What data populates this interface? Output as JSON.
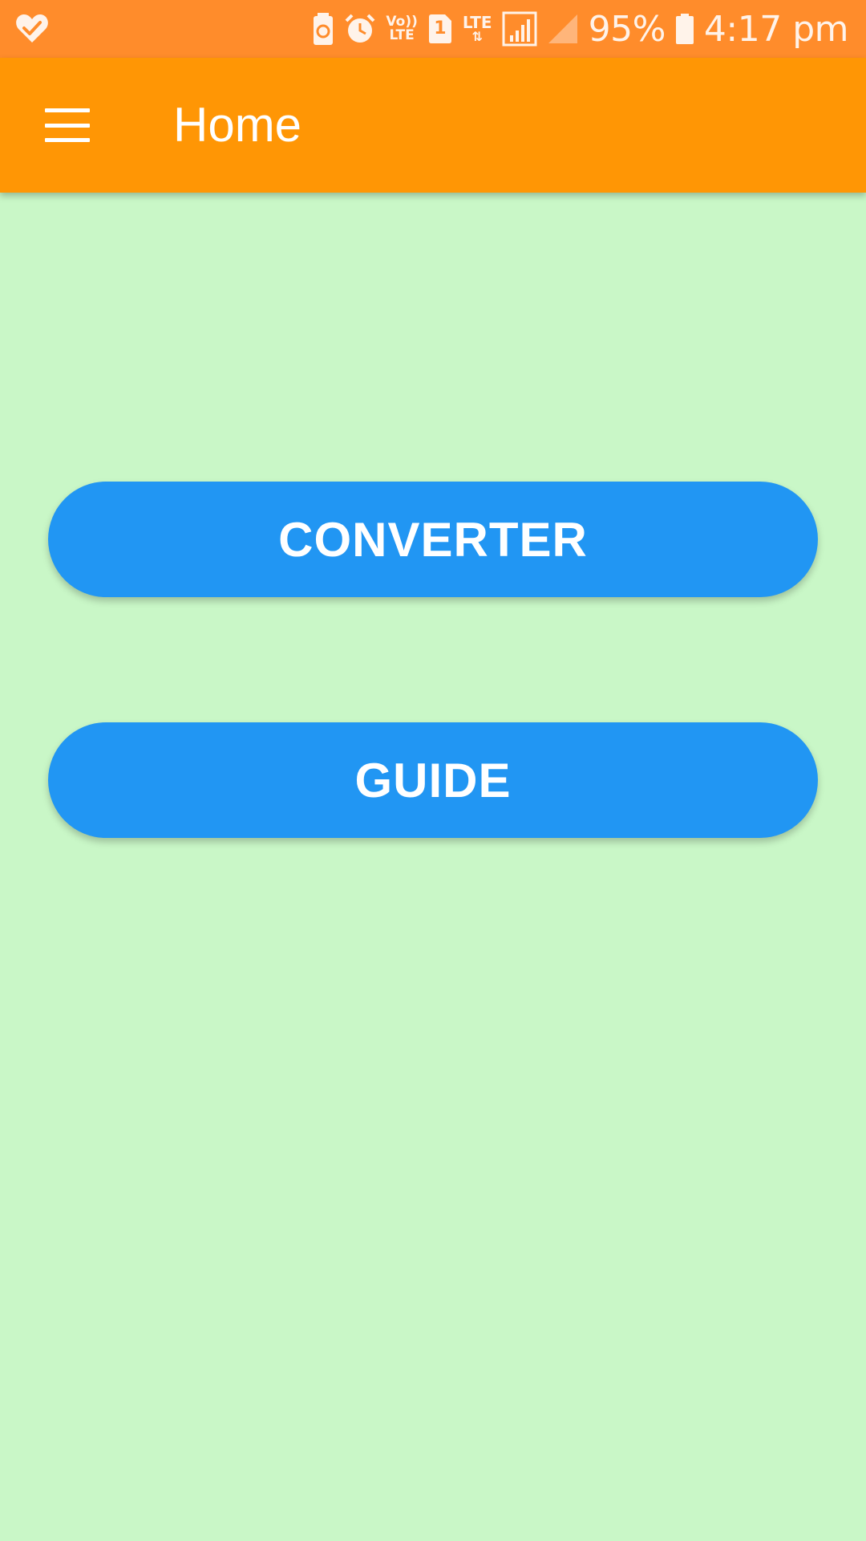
{
  "status_bar": {
    "battery_percent": "95%",
    "time": "4:17 pm",
    "volte_top": "Vo))",
    "volte_bottom": "LTE",
    "sim_slot": "1",
    "lte_label": "LTE",
    "icons": [
      "heart-check-icon",
      "battery-saver-icon",
      "alarm-icon",
      "volte-icon",
      "sim-icon",
      "lte-data-icon",
      "signal-icon",
      "signal-empty-icon",
      "battery-icon"
    ],
    "colors": {
      "background": "#ff8c2b",
      "foreground": "#fff3ea"
    }
  },
  "app_bar": {
    "title": "Home",
    "menu_icon": "hamburger-menu-icon",
    "background": "#ff9605"
  },
  "main": {
    "background": "#c9f7c7",
    "buttons": [
      {
        "label": "CONVERTER",
        "color": "#2196f3"
      },
      {
        "label": "GUIDE",
        "color": "#2196f3"
      }
    ]
  }
}
